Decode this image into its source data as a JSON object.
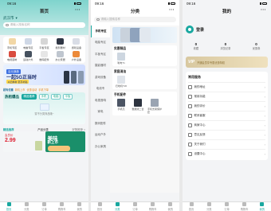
{
  "status": {
    "time": "09:16"
  },
  "more_glyph": "···",
  "tabs": [
    "首页",
    "分类",
    "订单",
    "购物车",
    "我的"
  ],
  "home": {
    "title": "首页",
    "location": "武汉市",
    "search_placeholder": "请输入搜索名称",
    "categories": [
      {
        "label": "手机专区",
        "color": "#f2d7a6"
      },
      {
        "label": "电脑专区",
        "color": "#cfd8e6"
      },
      {
        "label": "平板专区",
        "color": "#d6d6d6"
      },
      {
        "label": "摄影器材",
        "color": "#2f3644"
      },
      {
        "label": "游戏设备",
        "color": "#d9dde6"
      },
      {
        "label": "电视音响",
        "color": "#d94c3f"
      },
      {
        "label": "运动户外",
        "color": "#46515f"
      },
      {
        "label": "数码配件",
        "color": "#e6e6e6"
      },
      {
        "label": "办公家居",
        "color": "#bfc6cf"
      },
      {
        "label": "户外设备",
        "color": "#ec8a3a"
      }
    ],
    "banner": {
      "tag": "百元焕新",
      "headline": "一起5G正当时",
      "sub": "以旧换新 至高补贴"
    },
    "ticker": {
      "title": "超有优惠",
      "items": [
        "新机上市",
        "优惠活动",
        "手机下单"
      ]
    },
    "hot": {
      "title": "热租爆品",
      "chips": [
        "精品推荐",
        "手机",
        "电脑",
        "平板"
      ],
      "empty": "暂不分类商品哦~"
    },
    "recommend": {
      "left": "精选推荐",
      "mid": "产品分类",
      "right": "好物推荐 >"
    },
    "promos": [
      {
        "line1": "会员价",
        "line2": "2.99"
      },
      {
        "line1": "美味",
        "line2": "新上市"
      }
    ]
  },
  "category": {
    "title": "分类",
    "search_placeholder": "请输入搜索名称",
    "side": [
      "手机专区",
      "电脑专区",
      "平板专区",
      "摄影器材",
      "游戏设备",
      "电池专",
      "电视音响",
      "家电",
      "数码配件",
      "运动户外",
      "办公家具"
    ],
    "sections": [
      {
        "title": "实惠精品",
        "items": [
          "笔电T1"
        ]
      },
      {
        "title": "家庭清洁",
        "items": [
          "扫地机T20"
        ]
      },
      {
        "title": "手机配件",
        "items": [
          "手机壳",
          "数据线二合",
          "手机支架保护套"
        ]
      }
    ]
  },
  "mine": {
    "title": "我的",
    "login": "登录",
    "stats": [
      {
        "value": "0",
        "label": "收藏"
      },
      {
        "value": "0",
        "label": "浏览记录"
      },
      {
        "value": "0",
        "label": "优惠券"
      }
    ],
    "vip": {
      "logo": "VIP",
      "text": "开通会员享专属优惠特权"
    },
    "services_title": "常用服务",
    "services": [
      "我的地址",
      "常用功能",
      "我的评价",
      "联系客服",
      "商家中心",
      "意见反馈",
      "关于我们",
      "设置中心"
    ]
  }
}
